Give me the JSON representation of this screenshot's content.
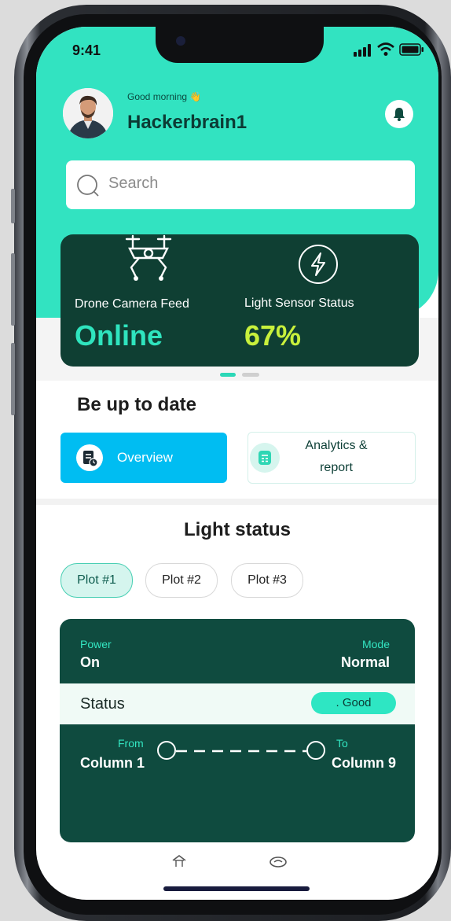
{
  "status_bar": {
    "time": "9:41"
  },
  "header": {
    "greeting": "Good morning 👋",
    "username": "Hackerbrain1"
  },
  "search": {
    "placeholder": "Search"
  },
  "summary_card": {
    "drone": {
      "label": "Drone Camera Feed",
      "value": "Online",
      "value_color": "#2fe4be"
    },
    "light": {
      "label": "Light Sensor Status",
      "value": "67%",
      "value_color": "#c8f03c"
    }
  },
  "section_title": "Be up to date",
  "actions": {
    "overview": "Overview",
    "analytics_line1": "Analytics &",
    "analytics_line2": "report"
  },
  "light_status": {
    "title": "Light status",
    "plots": [
      "Plot #1",
      "Plot #2",
      "Plot #3"
    ],
    "power_label": "Power",
    "power_value": "On",
    "mode_label": "Mode",
    "mode_value": "Normal",
    "status_label": "Status",
    "status_value": ". Good",
    "from_label": "From",
    "from_value": "Column 1",
    "to_label": "To",
    "to_value": "Column 9"
  },
  "colors": {
    "accent": "#32e3c1",
    "card": "#0f3f33",
    "primary_button": "#00bdf2"
  },
  "icons": [
    "bell-icon",
    "search-icon",
    "drone-icon",
    "lightning-icon",
    "report-icon",
    "calculator-icon",
    "home-icon",
    "chat-icon"
  ]
}
